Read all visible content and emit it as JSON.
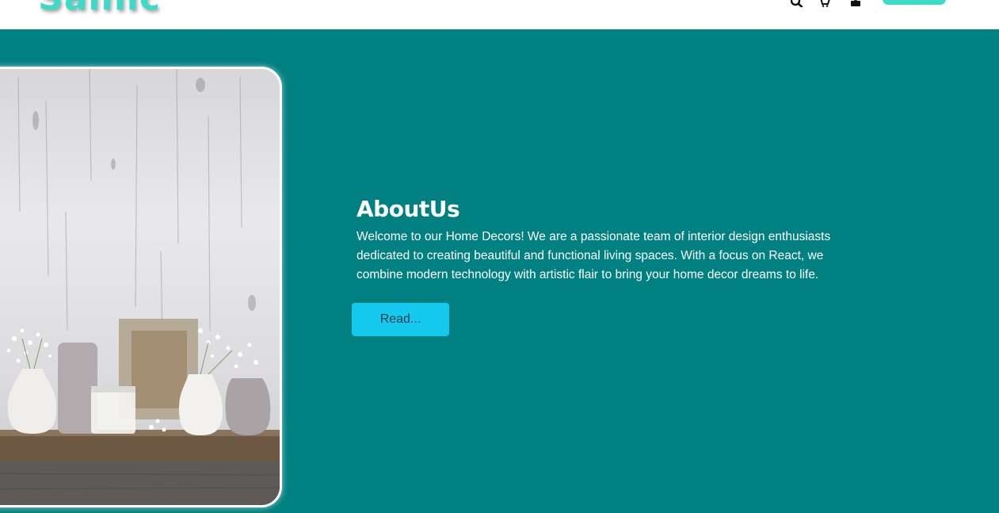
{
  "header": {
    "logo_text": "Salhic",
    "icons": [
      "search-icon",
      "cart-icon",
      "user-icon"
    ],
    "accent_color": "#3ddbc6"
  },
  "about": {
    "heading": "AboutUs",
    "body": "Welcome to our Home Decors! We are a passionate team of interior design enthusiasts dedicated to creating beautiful and functional living spaces. With a focus on React, we combine modern technology with artistic flair to bring your home decor dreams to life.",
    "button_label": "Read...",
    "background_color": "#008080",
    "button_color": "#14c8ee"
  }
}
